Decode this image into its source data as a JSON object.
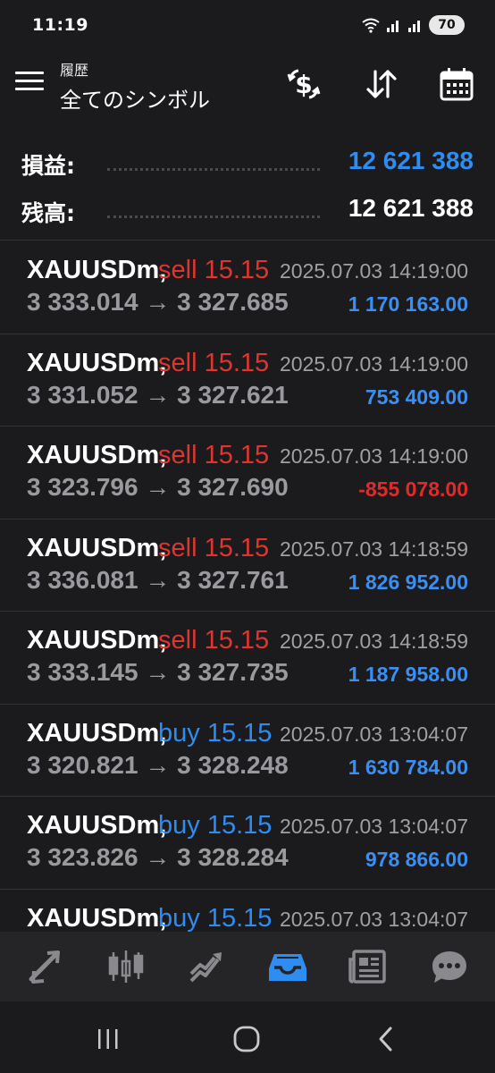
{
  "status_bar": {
    "time": "11:19",
    "battery": "70"
  },
  "header": {
    "subtitle": "履歴",
    "title": "全てのシンボル"
  },
  "summary": {
    "profit_label": "損益:",
    "profit_value": "12 621 388",
    "balance_label": "残高:",
    "balance_value": "12 621 388"
  },
  "trades": [
    {
      "symbol": "XAUUSDm,",
      "side": "sell 15.15",
      "time": "2025.07.03 14:19:00",
      "prices": "3 333.014 → 3 327.685",
      "profit": "1 170 163.00",
      "positive": true
    },
    {
      "symbol": "XAUUSDm,",
      "side": "sell 15.15",
      "time": "2025.07.03 14:19:00",
      "prices": "3 331.052 → 3 327.621",
      "profit": "753 409.00",
      "positive": true
    },
    {
      "symbol": "XAUUSDm,",
      "side": "sell 15.15",
      "time": "2025.07.03 14:19:00",
      "prices": "3 323.796 → 3 327.690",
      "profit": "-855 078.00",
      "positive": false
    },
    {
      "symbol": "XAUUSDm,",
      "side": "sell 15.15",
      "time": "2025.07.03 14:18:59",
      "prices": "3 336.081 → 3 327.761",
      "profit": "1 826 952.00",
      "positive": true
    },
    {
      "symbol": "XAUUSDm,",
      "side": "sell 15.15",
      "time": "2025.07.03 14:18:59",
      "prices": "3 333.145 → 3 327.735",
      "profit": "1 187 958.00",
      "positive": true
    },
    {
      "symbol": "XAUUSDm,",
      "side": "buy 15.15",
      "time": "2025.07.03 13:04:07",
      "prices": "3 320.821 → 3 328.248",
      "profit": "1 630 784.00",
      "positive": true
    },
    {
      "symbol": "XAUUSDm,",
      "side": "buy 15.15",
      "time": "2025.07.03 13:04:07",
      "prices": "3 323.826 → 3 328.284",
      "profit": "978 866.00",
      "positive": true
    },
    {
      "symbol": "XAUUSDm,",
      "side": "buy 15.15",
      "time": "2025.07.03 13:04:07",
      "prices": "",
      "profit": "",
      "positive": true
    }
  ],
  "bottom_nav": [
    {
      "icon": "quotes-arrows-icon",
      "active": false
    },
    {
      "icon": "candlestick-chart-icon",
      "active": false
    },
    {
      "icon": "trade-chart-icon",
      "active": false
    },
    {
      "icon": "history-inbox-icon",
      "active": true
    },
    {
      "icon": "news-icon",
      "active": false
    },
    {
      "icon": "chat-icon",
      "active": false
    }
  ],
  "colors": {
    "background": "#1b1b1d",
    "accent_blue": "#2f8cf0",
    "sell_red": "#e0342f",
    "buy_blue": "#2f8cf0",
    "profit_blue": "#3c8ff2",
    "loss_red": "#e22a2a",
    "muted_text": "#9a9a9e"
  }
}
